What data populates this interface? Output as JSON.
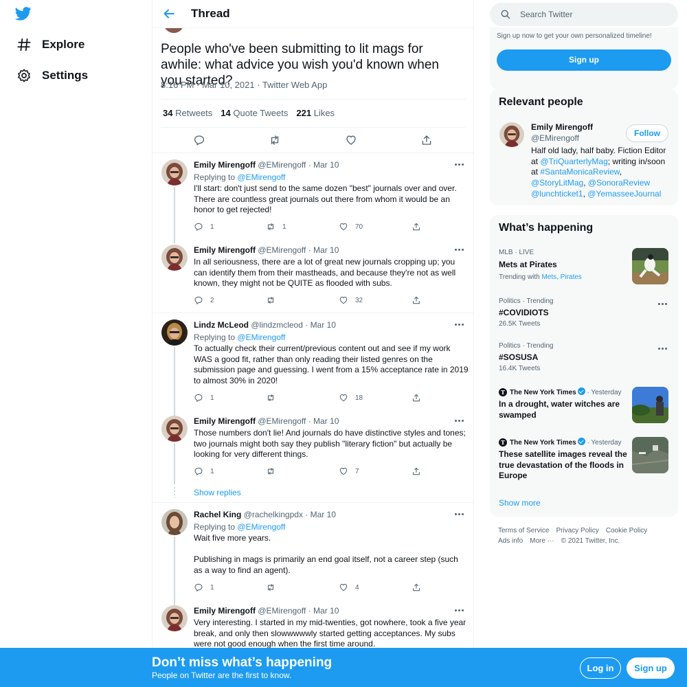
{
  "nav": {
    "logo_icon": "twitter-bird-icon",
    "items": [
      {
        "label": "Explore",
        "icon": "hashtag-icon"
      },
      {
        "label": "Settings",
        "icon": "gear-icon"
      }
    ]
  },
  "header": {
    "title": "Thread"
  },
  "main_tweet": {
    "text": "People who've been submitting to lit mags for awhile: what advice you wish you'd known when you started?",
    "timestamp": "8:16 PM · Mar 10, 2021 · Twitter Web App",
    "stats": [
      {
        "count": "34",
        "label": "Retweets"
      },
      {
        "count": "14",
        "label": "Quote Tweets"
      },
      {
        "count": "221",
        "label": "Likes"
      }
    ]
  },
  "replies": [
    {
      "name": "Emily Mirengoff",
      "handle": "@EMirengoff",
      "date": "· Mar 10",
      "replying_label": "Replying to",
      "replying_to": "@EMirengoff",
      "text": "I'll start: don't just send to the same dozen \"best\" journals over and over. There are countless great journals out there from whom it would be an honor to get rejected!",
      "replies": "1",
      "retweets": "1",
      "likes": "70"
    },
    {
      "name": "Emily Mirengoff",
      "handle": "@EMirengoff",
      "date": "· Mar 10",
      "text": "In all seriousness, there are a lot of great new journals cropping up; you can identify them from their mastheads, and because they're not as well known, they might not be QUITE as flooded with subs.",
      "replies": "2",
      "retweets": "",
      "likes": "32"
    },
    {
      "name": "Lindz McLeod",
      "handle": "@lindzmcleod",
      "date": "· Mar 10",
      "replying_label": "Replying to",
      "replying_to": "@EMirengoff",
      "text": "To actually check their current/previous content out and see if my work WAS a good fit, rather than only reading their listed genres on the submission page and guessing. I went from a 15% acceptance rate in 2019 to almost 30% in 2020!",
      "replies": "1",
      "retweets": "",
      "likes": "18"
    },
    {
      "name": "Emily Mirengoff",
      "handle": "@EMirengoff",
      "date": "· Mar 10",
      "text": "Those numbers don't lie! And journals do have distinctive styles and tones; two journals might both say they publish \"literary fiction\" but actually be looking for very different things.",
      "replies": "1",
      "retweets": "",
      "likes": "7"
    },
    {
      "name": "Rachel King",
      "handle": "@rachelkingpdx",
      "date": "· Mar 10",
      "replying_label": "Replying to",
      "replying_to": "@EMirengoff",
      "text": "Wait five more years.",
      "text2": "Publishing in mags is primarily an end goal itself, not a career step (such as a way to find an agent).",
      "replies": "1",
      "retweets": "",
      "likes": "4"
    },
    {
      "name": "Emily Mirengoff",
      "handle": "@EMirengoff",
      "date": "· Mar 10",
      "text": "Very interesting. I started in my mid-twenties, got nowhere, took a five year break, and only then slowwwwwly started getting acceptances. My subs were not good enough when the first time around."
    }
  ],
  "show_replies": "Show replies",
  "search": {
    "placeholder": "Search Twitter"
  },
  "signup_card": {
    "text": "Sign up now to get your own personalized timeline!",
    "button": "Sign up"
  },
  "relevant_people": {
    "title": "Relevant people",
    "name": "Emily Mirengoff",
    "handle": "@EMirengoff",
    "follow": "Follow",
    "bio_1": "Half old lady, half baby. Fiction Editor at ",
    "bio_link_1": "@TriQuarterlyMag",
    "bio_2": "; writing in/soon at ",
    "bio_link_2": "#SantaMonicaReview",
    "bio_3": ", ",
    "bio_link_3": "@StoryLitMag",
    "bio_4": ", ",
    "bio_link_4": "@SonoraReview",
    "bio_5": " ",
    "bio_link_5": "@lunchticket1",
    "bio_6": ", ",
    "bio_link_6": "@YemasseeJournal"
  },
  "happening": {
    "title": "What’s happening",
    "trends": [
      {
        "category": "MLB · LIVE",
        "title": "Mets at Pirates",
        "sub_prefix": "Trending with",
        "sub_links": "Mets, Pirates"
      },
      {
        "category": "Politics · Trending",
        "title": "#COVIDIOTS",
        "sub": "26.5K Tweets"
      },
      {
        "category": "Politics · Trending",
        "title": "#SOSUSA",
        "sub": "16.4K Tweets"
      },
      {
        "source": "The New York Times",
        "time": "· Yesterday",
        "title": "In a drought, water witches are swamped"
      },
      {
        "source": "The New York Times",
        "time": "· Yesterday",
        "title": "These satellite images reveal the true devastation of the floods in Europe"
      }
    ],
    "show_more": "Show more"
  },
  "footer": {
    "links_1": [
      "Terms of Service",
      "Privacy Policy",
      "Cookie Policy"
    ],
    "links_2": [
      "Ads info",
      "More ···",
      "© 2021 Twitter, Inc."
    ]
  },
  "bottom_bar": {
    "title": "Don’t miss what’s happening",
    "subtitle": "People on Twitter are the first to know.",
    "login": "Log in",
    "signup": "Sign up"
  },
  "colors": {
    "accent": "#1d9bf0",
    "text": "#0f1419",
    "muted": "#536471"
  }
}
